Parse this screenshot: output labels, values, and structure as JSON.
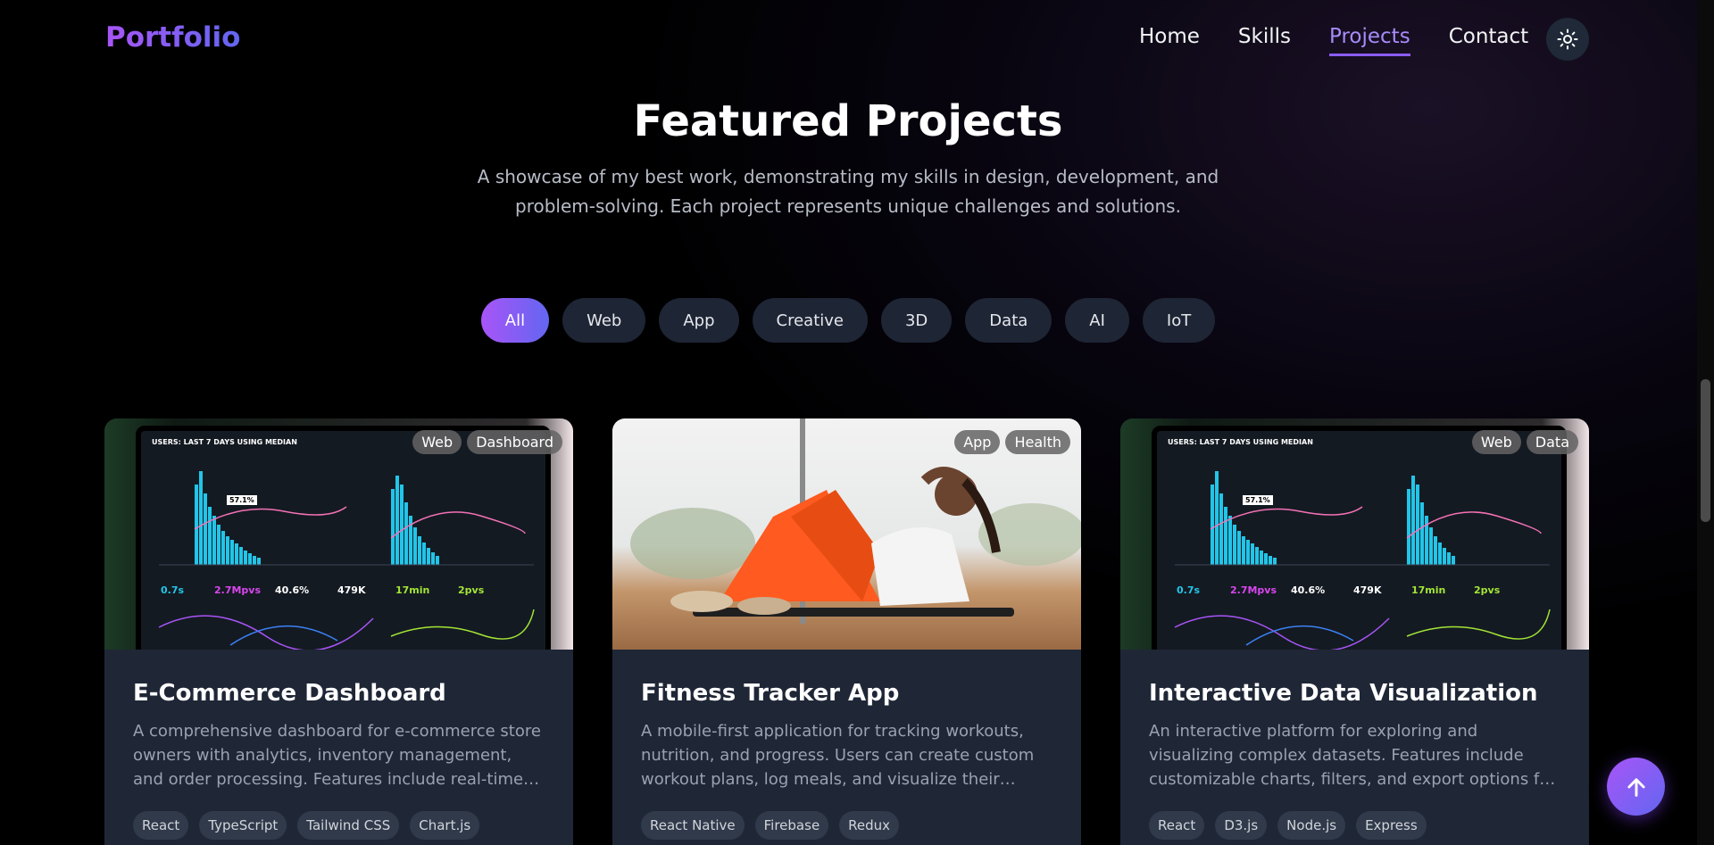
{
  "nav": {
    "logo": "Portfolio",
    "links": [
      {
        "label": "Home"
      },
      {
        "label": "Skills"
      },
      {
        "label": "Projects",
        "active": true
      },
      {
        "label": "Contact"
      }
    ],
    "theme_toggle_icon": "sun-icon"
  },
  "header": {
    "title": "Featured Projects",
    "subtitle": "A showcase of my best work, demonstrating my skills in design, development, and problem-solving. Each project represents unique challenges and solutions."
  },
  "filters": [
    "All",
    "Web",
    "App",
    "Creative",
    "3D",
    "Data",
    "AI",
    "IoT"
  ],
  "active_filter": "All",
  "projects": [
    {
      "title": "E-Commerce Dashboard",
      "description": "A comprehensive dashboard for e-commerce store owners with analytics, inventory management, and order processing. Features include real-time sales tracking and reporting.",
      "categories": [
        "Web",
        "Dashboard"
      ],
      "tech": [
        "React",
        "TypeScript",
        "Tailwind CSS",
        "Chart.js"
      ],
      "image": "analytics-dashboard-laptop",
      "screen_text": {
        "heading": "USERS: LAST 7 DAYS USING MEDIAN",
        "metric_1": "0.7s",
        "metric_2": "2.7Mpvs",
        "metric_3": "40.6%",
        "metric_4": "479K",
        "metric_5": "17min",
        "metric_6": "2pvs",
        "callout": "57.1%"
      }
    },
    {
      "title": "Fitness Tracker App",
      "description": "A mobile-first application for tracking workouts, nutrition, and progress. Users can create custom workout plans, log meals, and visualize their fitness journey.",
      "categories": [
        "App",
        "Health"
      ],
      "tech": [
        "React Native",
        "Firebase",
        "Redux"
      ],
      "image": "woman-doing-situps"
    },
    {
      "title": "Interactive Data Visualization",
      "description": "An interactive platform for exploring and visualizing complex datasets. Features include customizable charts, filters, and export options for data analysis.",
      "categories": [
        "Web",
        "Data"
      ],
      "tech": [
        "React",
        "D3.js",
        "Node.js",
        "Express"
      ],
      "image": "analytics-dashboard-laptop",
      "screen_text": {
        "heading": "USERS: LAST 7 DAYS USING MEDIAN",
        "metric_1": "0.7s",
        "metric_2": "2.7Mpvs",
        "metric_3": "40.6%",
        "metric_4": "479K",
        "metric_5": "17min",
        "metric_6": "2pvs",
        "callout": "57.1%"
      }
    }
  ],
  "scroll_top_icon": "arrow-up-icon",
  "colors": {
    "accent_start": "#a855f7",
    "accent_end": "#6366f1",
    "card_bg": "#1f2737",
    "pill_bg": "#1e2535"
  }
}
